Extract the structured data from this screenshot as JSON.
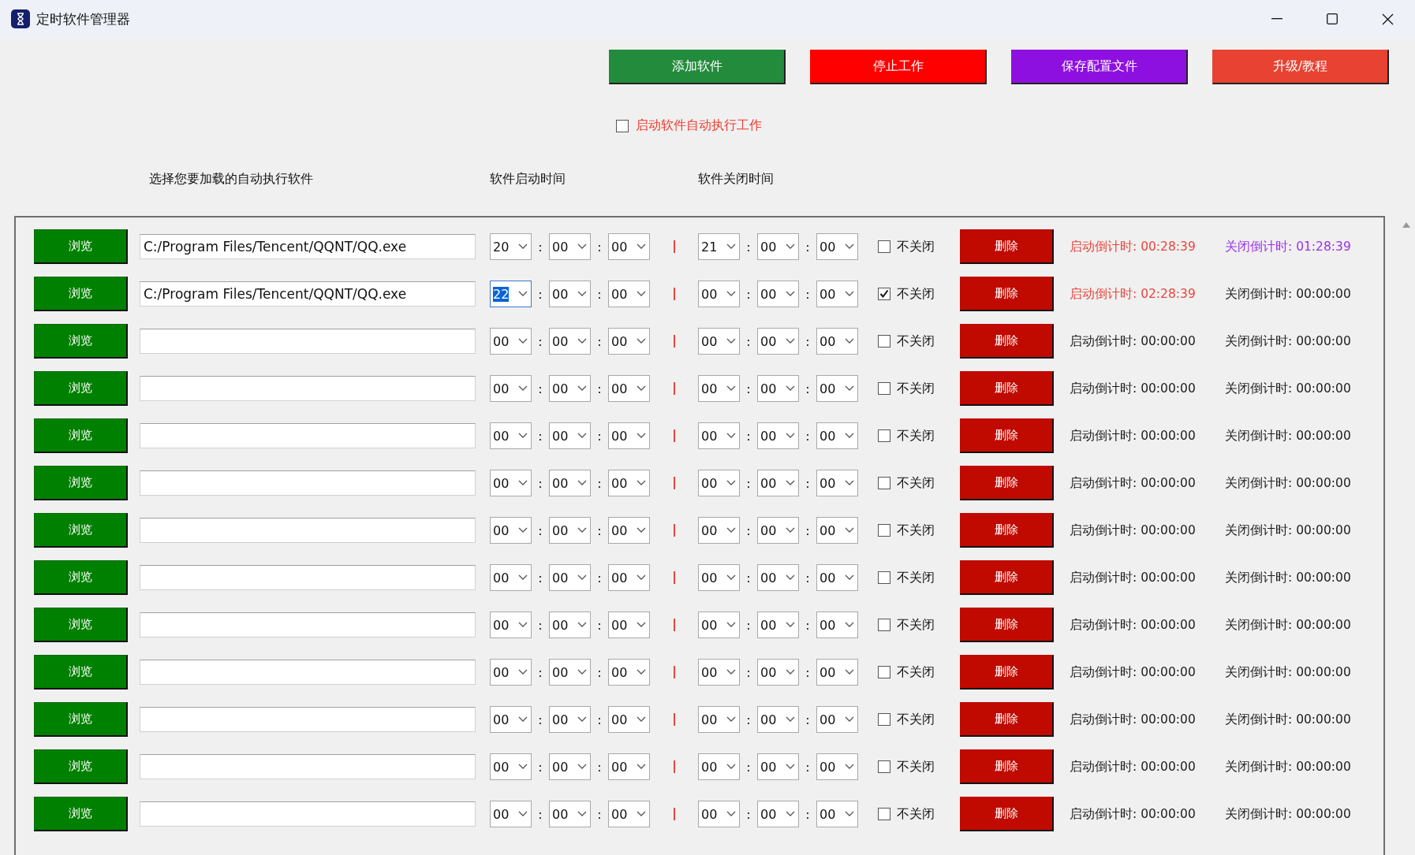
{
  "window": {
    "title": "定时软件管理器"
  },
  "toolbar": [
    {
      "label": "添加软件",
      "color": "#228b3c"
    },
    {
      "label": "停止工作",
      "color": "#ff0000"
    },
    {
      "label": "保存配置文件",
      "color": "#8e10e0"
    },
    {
      "label": "升级/教程",
      "color": "#e84232"
    }
  ],
  "auto_start": {
    "label": "启动软件自动执行工作",
    "checked": false
  },
  "headers": [
    "选择您要加载的自动执行软件",
    "软件启动时间",
    "软件关闭时间"
  ],
  "rows": [
    {
      "browse": "浏览",
      "path": "C:/Program Files/Tencent/QQNT/QQ.exe",
      "separators": [
        ":",
        ":",
        ":",
        ":"
      ],
      "start": [
        {
          "value": "20",
          "focused": false
        },
        {
          "value": "00",
          "focused": false
        },
        {
          "value": "00",
          "focused": false
        }
      ],
      "close": [
        {
          "value": "21",
          "focused": false
        },
        {
          "value": "00",
          "focused": false
        },
        {
          "value": "00",
          "focused": false
        }
      ],
      "no_close": {
        "label": "不关闭",
        "checked": false
      },
      "delete": "删除",
      "start_countdown": {
        "text": "启动倒计时: 00:28:39",
        "color": "#e8453c"
      },
      "close_countdown": {
        "text": "关闭倒计时: 01:28:39",
        "color": "#9b30e8"
      }
    },
    {
      "browse": "浏览",
      "path": "C:/Program Files/Tencent/QQNT/QQ.exe",
      "separators": [
        ":",
        ":",
        ":",
        ":"
      ],
      "start": [
        {
          "value": "22",
          "focused": true
        },
        {
          "value": "00",
          "focused": false
        },
        {
          "value": "00",
          "focused": false
        }
      ],
      "close": [
        {
          "value": "00",
          "focused": false
        },
        {
          "value": "00",
          "focused": false
        },
        {
          "value": "00",
          "focused": false
        }
      ],
      "no_close": {
        "label": "不关闭",
        "checked": true
      },
      "delete": "删除",
      "start_countdown": {
        "text": "启动倒计时: 02:28:39",
        "color": "#e8453c"
      },
      "close_countdown": {
        "text": "关闭倒计时: 00:00:00",
        "color": "#1a1a1a"
      }
    },
    {
      "browse": "浏览",
      "separators": [
        ":",
        ":",
        ":",
        ":"
      ],
      "start": [
        {
          "value": "00",
          "focused": false
        },
        {
          "value": "00",
          "focused": false
        },
        {
          "value": "00",
          "focused": false
        }
      ],
      "close": [
        {
          "value": "00",
          "focused": false
        },
        {
          "value": "00",
          "focused": false
        },
        {
          "value": "00",
          "focused": false
        }
      ],
      "no_close": {
        "label": "不关闭",
        "checked": false
      },
      "delete": "删除",
      "start_countdown": {
        "text": "启动倒计时: 00:00:00",
        "color": "#1a1a1a"
      },
      "close_countdown": {
        "text": "关闭倒计时: 00:00:00",
        "color": "#1a1a1a"
      }
    },
    {
      "browse": "浏览",
      "separators": [
        ":",
        ":",
        ":",
        ":"
      ],
      "start": [
        {
          "value": "00",
          "focused": false
        },
        {
          "value": "00",
          "focused": false
        },
        {
          "value": "00",
          "focused": false
        }
      ],
      "close": [
        {
          "value": "00",
          "focused": false
        },
        {
          "value": "00",
          "focused": false
        },
        {
          "value": "00",
          "focused": false
        }
      ],
      "no_close": {
        "label": "不关闭",
        "checked": false
      },
      "delete": "删除",
      "start_countdown": {
        "text": "启动倒计时: 00:00:00",
        "color": "#1a1a1a"
      },
      "close_countdown": {
        "text": "关闭倒计时: 00:00:00",
        "color": "#1a1a1a"
      }
    },
    {
      "browse": "浏览",
      "separators": [
        ":",
        ":",
        ":",
        ":"
      ],
      "start": [
        {
          "value": "00",
          "focused": false
        },
        {
          "value": "00",
          "focused": false
        },
        {
          "value": "00",
          "focused": false
        }
      ],
      "close": [
        {
          "value": "00",
          "focused": false
        },
        {
          "value": "00",
          "focused": false
        },
        {
          "value": "00",
          "focused": false
        }
      ],
      "no_close": {
        "label": "不关闭",
        "checked": false
      },
      "delete": "删除",
      "start_countdown": {
        "text": "启动倒计时: 00:00:00",
        "color": "#1a1a1a"
      },
      "close_countdown": {
        "text": "关闭倒计时: 00:00:00",
        "color": "#1a1a1a"
      }
    },
    {
      "browse": "浏览",
      "separators": [
        ":",
        ":",
        ":",
        ":"
      ],
      "start": [
        {
          "value": "00",
          "focused": false
        },
        {
          "value": "00",
          "focused": false
        },
        {
          "value": "00",
          "focused": false
        }
      ],
      "close": [
        {
          "value": "00",
          "focused": false
        },
        {
          "value": "00",
          "focused": false
        },
        {
          "value": "00",
          "focused": false
        }
      ],
      "no_close": {
        "label": "不关闭",
        "checked": false
      },
      "delete": "删除",
      "start_countdown": {
        "text": "启动倒计时: 00:00:00",
        "color": "#1a1a1a"
      },
      "close_countdown": {
        "text": "关闭倒计时: 00:00:00",
        "color": "#1a1a1a"
      }
    },
    {
      "browse": "浏览",
      "separators": [
        ":",
        ":",
        ":",
        ":"
      ],
      "start": [
        {
          "value": "00",
          "focused": false
        },
        {
          "value": "00",
          "focused": false
        },
        {
          "value": "00",
          "focused": false
        }
      ],
      "close": [
        {
          "value": "00",
          "focused": false
        },
        {
          "value": "00",
          "focused": false
        },
        {
          "value": "00",
          "focused": false
        }
      ],
      "no_close": {
        "label": "不关闭",
        "checked": false
      },
      "delete": "删除",
      "start_countdown": {
        "text": "启动倒计时: 00:00:00",
        "color": "#1a1a1a"
      },
      "close_countdown": {
        "text": "关闭倒计时: 00:00:00",
        "color": "#1a1a1a"
      }
    },
    {
      "browse": "浏览",
      "separators": [
        ":",
        ":",
        ":",
        ":"
      ],
      "start": [
        {
          "value": "00",
          "focused": false
        },
        {
          "value": "00",
          "focused": false
        },
        {
          "value": "00",
          "focused": false
        }
      ],
      "close": [
        {
          "value": "00",
          "focused": false
        },
        {
          "value": "00",
          "focused": false
        },
        {
          "value": "00",
          "focused": false
        }
      ],
      "no_close": {
        "label": "不关闭",
        "checked": false
      },
      "delete": "删除",
      "start_countdown": {
        "text": "启动倒计时: 00:00:00",
        "color": "#1a1a1a"
      },
      "close_countdown": {
        "text": "关闭倒计时: 00:00:00",
        "color": "#1a1a1a"
      }
    },
    {
      "browse": "浏览",
      "separators": [
        ":",
        ":",
        ":",
        ":"
      ],
      "start": [
        {
          "value": "00",
          "focused": false
        },
        {
          "value": "00",
          "focused": false
        },
        {
          "value": "00",
          "focused": false
        }
      ],
      "close": [
        {
          "value": "00",
          "focused": false
        },
        {
          "value": "00",
          "focused": false
        },
        {
          "value": "00",
          "focused": false
        }
      ],
      "no_close": {
        "label": "不关闭",
        "checked": false
      },
      "delete": "删除",
      "start_countdown": {
        "text": "启动倒计时: 00:00:00",
        "color": "#1a1a1a"
      },
      "close_countdown": {
        "text": "关闭倒计时: 00:00:00",
        "color": "#1a1a1a"
      }
    },
    {
      "browse": "浏览",
      "separators": [
        ":",
        ":",
        ":",
        ":"
      ],
      "start": [
        {
          "value": "00",
          "focused": false
        },
        {
          "value": "00",
          "focused": false
        },
        {
          "value": "00",
          "focused": false
        }
      ],
      "close": [
        {
          "value": "00",
          "focused": false
        },
        {
          "value": "00",
          "focused": false
        },
        {
          "value": "00",
          "focused": false
        }
      ],
      "no_close": {
        "label": "不关闭",
        "checked": false
      },
      "delete": "删除",
      "start_countdown": {
        "text": "启动倒计时: 00:00:00",
        "color": "#1a1a1a"
      },
      "close_countdown": {
        "text": "关闭倒计时: 00:00:00",
        "color": "#1a1a1a"
      }
    },
    {
      "browse": "浏览",
      "separators": [
        ":",
        ":",
        ":",
        ":"
      ],
      "start": [
        {
          "value": "00",
          "focused": false
        },
        {
          "value": "00",
          "focused": false
        },
        {
          "value": "00",
          "focused": false
        }
      ],
      "close": [
        {
          "value": "00",
          "focused": false
        },
        {
          "value": "00",
          "focused": false
        },
        {
          "value": "00",
          "focused": false
        }
      ],
      "no_close": {
        "label": "不关闭",
        "checked": false
      },
      "delete": "删除",
      "start_countdown": {
        "text": "启动倒计时: 00:00:00",
        "color": "#1a1a1a"
      },
      "close_countdown": {
        "text": "关闭倒计时: 00:00:00",
        "color": "#1a1a1a"
      }
    },
    {
      "browse": "浏览",
      "separators": [
        ":",
        ":",
        ":",
        ":"
      ],
      "start": [
        {
          "value": "00",
          "focused": false
        },
        {
          "value": "00",
          "focused": false
        },
        {
          "value": "00",
          "focused": false
        }
      ],
      "close": [
        {
          "value": "00",
          "focused": false
        },
        {
          "value": "00",
          "focused": false
        },
        {
          "value": "00",
          "focused": false
        }
      ],
      "no_close": {
        "label": "不关闭",
        "checked": false
      },
      "delete": "删除",
      "start_countdown": {
        "text": "启动倒计时: 00:00:00",
        "color": "#1a1a1a"
      },
      "close_countdown": {
        "text": "关闭倒计时: 00:00:00",
        "color": "#1a1a1a"
      }
    },
    {
      "browse": "浏览",
      "separators": [
        ":",
        ":",
        ":",
        ":"
      ],
      "start": [
        {
          "value": "00",
          "focused": false
        },
        {
          "value": "00",
          "focused": false
        },
        {
          "value": "00",
          "focused": false
        }
      ],
      "close": [
        {
          "value": "00",
          "focused": false
        },
        {
          "value": "00",
          "focused": false
        },
        {
          "value": "00",
          "focused": false
        }
      ],
      "no_close": {
        "label": "不关闭",
        "checked": false
      },
      "delete": "删除",
      "start_countdown": {
        "text": "启动倒计时: 00:00:00",
        "color": "#1a1a1a"
      },
      "close_countdown": {
        "text": "关闭倒计时: 00:00:00",
        "color": "#1a1a1a"
      }
    }
  ]
}
